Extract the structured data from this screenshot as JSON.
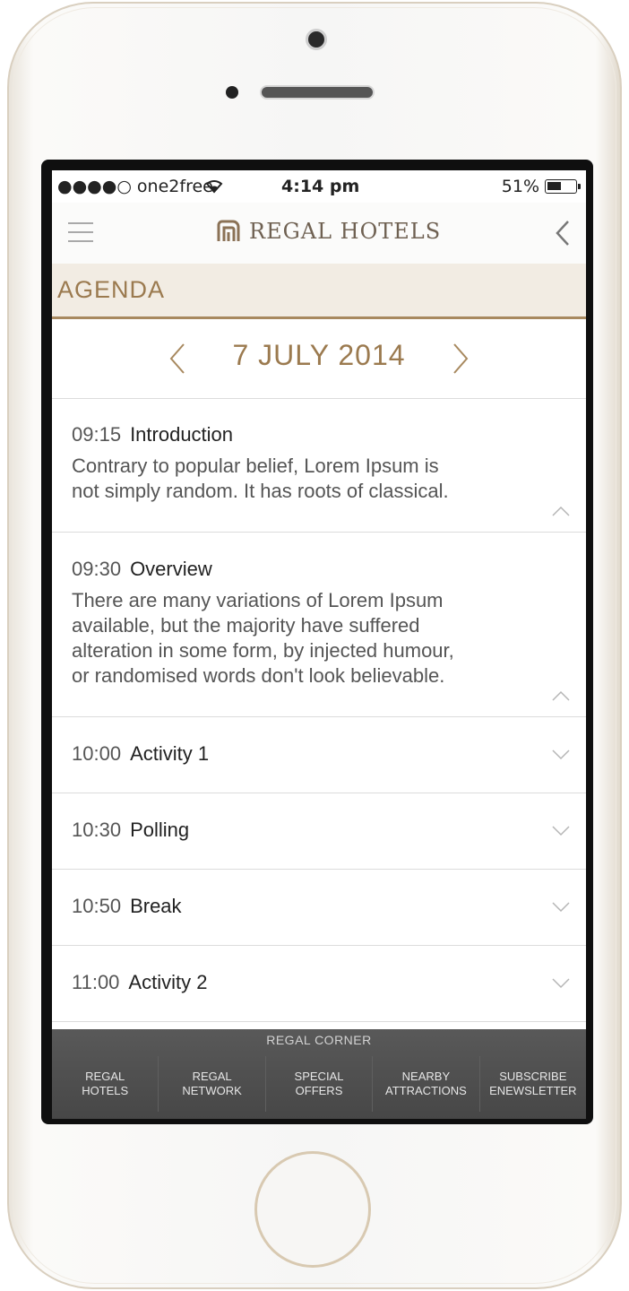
{
  "status_bar": {
    "carrier": "●●●●○ one2free",
    "time": "4:14 pm",
    "battery": "51%",
    "battery_level": 0.51
  },
  "navbar": {
    "brand": "REGAL HOTELS",
    "menu_icon": "hamburger-icon",
    "back_icon": "chevron-left-icon"
  },
  "page": {
    "title": "AGENDA",
    "date": "7 JULY 2014"
  },
  "agenda": [
    {
      "time": "09:15",
      "title": "Introduction",
      "desc_lines": [
        "Contrary to popular belief, Lorem Ipsum is",
        "not simply random. It has roots of classical."
      ],
      "expanded": true
    },
    {
      "time": "09:30",
      "title": "Overview",
      "desc_lines": [
        "There are many variations of Lorem Ipsum",
        "available, but the majority have suffered",
        "alteration in some form, by injected humour,",
        "or randomised words don't look believable."
      ],
      "expanded": true
    },
    {
      "time": "10:00",
      "title": "Activity 1",
      "expanded": false
    },
    {
      "time": "10:30",
      "title": "Polling",
      "expanded": false
    },
    {
      "time": "10:50",
      "title": "Break",
      "expanded": false
    },
    {
      "time": "11:00",
      "title": "Activity 2",
      "expanded": false
    }
  ],
  "footer": {
    "title": "REGAL CORNER",
    "tabs": [
      {
        "label": "REGAL\nHOTELS"
      },
      {
        "label": "REGAL\nNETWORK"
      },
      {
        "label": "SPECIAL\nOFFERS"
      },
      {
        "label": "NEARBY\nATTRACTIONS"
      },
      {
        "label": "SUBSCRIBE\nENEWSLETTER"
      }
    ]
  },
  "colors": {
    "accent": "#9b7a4f",
    "header_bg": "#f2ece3",
    "footer_bg": "#4f4f4f"
  }
}
